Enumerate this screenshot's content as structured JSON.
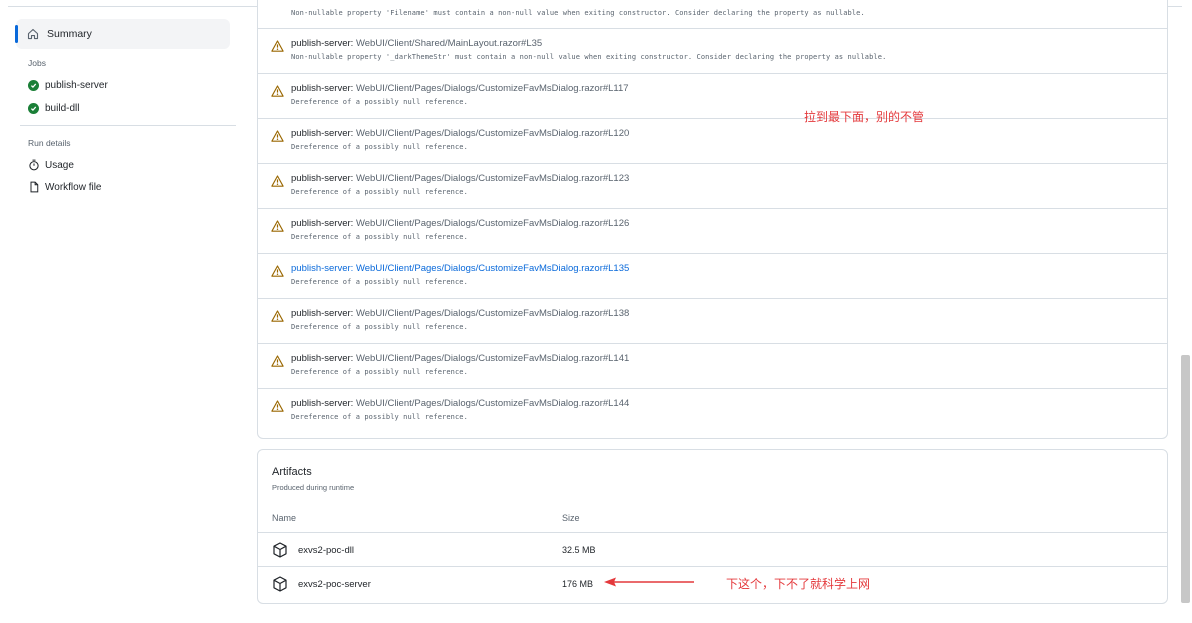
{
  "sidebar": {
    "summary_label": "Summary",
    "jobs_title": "Jobs",
    "jobs": [
      "publish-server",
      "build-dll"
    ],
    "run_details_title": "Run details",
    "run_details": [
      {
        "label": "Usage",
        "icon": "stopwatch-icon"
      },
      {
        "label": "Workflow file",
        "icon": "file-icon"
      }
    ]
  },
  "annotations": [
    {
      "job": "publish-server:",
      "path": "",
      "message": "Non-nullable property 'Filename' must contain a non-null value when exiting constructor. Consider declaring the property as nullable."
    },
    {
      "job": "publish-server:",
      "path": "WebUI/Client/Shared/MainLayout.razor#L35",
      "message": "Non-nullable property '_darkThemeStr' must contain a non-null value when exiting constructor. Consider declaring the property as nullable."
    },
    {
      "job": "publish-server:",
      "path": "WebUI/Client/Pages/Dialogs/CustomizeFavMsDialog.razor#L117",
      "message": "Dereference of a possibly null reference."
    },
    {
      "job": "publish-server:",
      "path": "WebUI/Client/Pages/Dialogs/CustomizeFavMsDialog.razor#L120",
      "message": "Dereference of a possibly null reference."
    },
    {
      "job": "publish-server:",
      "path": "WebUI/Client/Pages/Dialogs/CustomizeFavMsDialog.razor#L123",
      "message": "Dereference of a possibly null reference."
    },
    {
      "job": "publish-server:",
      "path": "WebUI/Client/Pages/Dialogs/CustomizeFavMsDialog.razor#L126",
      "message": "Dereference of a possibly null reference."
    },
    {
      "job": "publish-server:",
      "path": "WebUI/Client/Pages/Dialogs/CustomizeFavMsDialog.razor#L135",
      "message": "Dereference of a possibly null reference."
    },
    {
      "job": "publish-server:",
      "path": "WebUI/Client/Pages/Dialogs/CustomizeFavMsDialog.razor#L138",
      "message": "Dereference of a possibly null reference."
    },
    {
      "job": "publish-server:",
      "path": "WebUI/Client/Pages/Dialogs/CustomizeFavMsDialog.razor#L141",
      "message": "Dereference of a possibly null reference."
    },
    {
      "job": "publish-server:",
      "path": "WebUI/Client/Pages/Dialogs/CustomizeFavMsDialog.razor#L144",
      "message": "Dereference of a possibly null reference."
    }
  ],
  "artifacts": {
    "title": "Artifacts",
    "subtitle": "Produced during runtime",
    "col_name": "Name",
    "col_size": "Size",
    "rows": [
      {
        "name": "exvs2-poc-dll",
        "size": "32.5 MB"
      },
      {
        "name": "exvs2-poc-server",
        "size": "176 MB"
      }
    ]
  },
  "notes": {
    "scroll_note": "拉到最下面，别的不管",
    "download_note": "下这个，下不了就科学上网"
  },
  "colors": {
    "accent": "#0969da",
    "success": "#1a7f37",
    "warning": "#9a6700",
    "annotation_red": "#e4393c"
  }
}
